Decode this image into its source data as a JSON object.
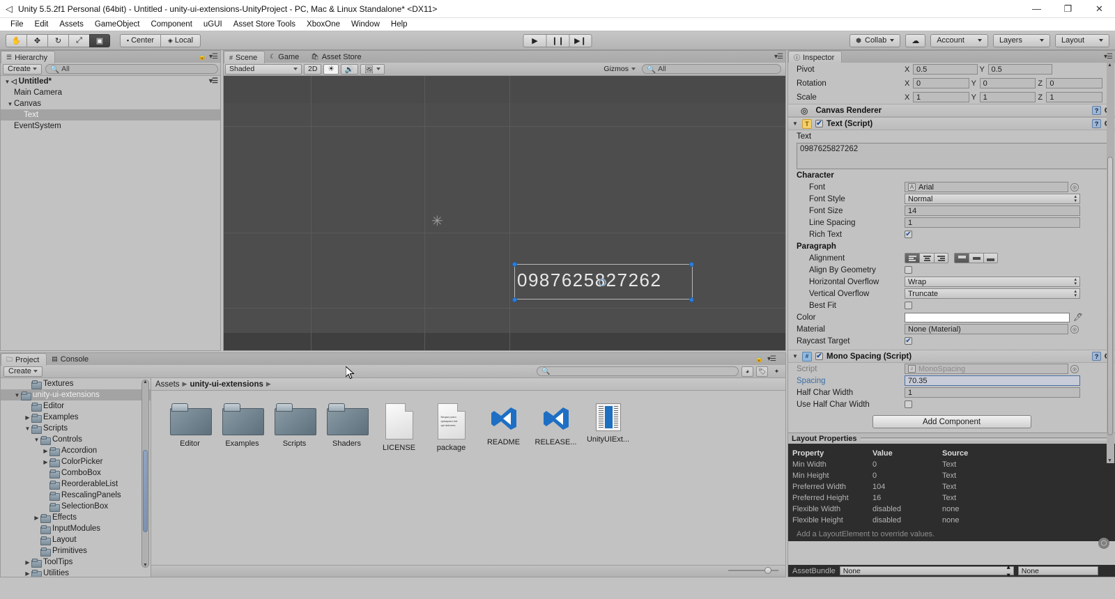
{
  "window": {
    "title": "Unity 5.5.2f1 Personal (64bit) - Untitled - unity-ui-extensions-UnityProject - PC, Mac & Linux Standalone* <DX11>",
    "app_icon": "unity-logo-icon",
    "minimize": "—",
    "maximize": "❐",
    "close": "✕"
  },
  "menubar": {
    "items": [
      "File",
      "Edit",
      "Assets",
      "GameObject",
      "Component",
      "uGUI",
      "Asset Store Tools",
      "XboxOne",
      "Window",
      "Help"
    ]
  },
  "toolbar": {
    "tools": [
      {
        "name": "hand-tool",
        "glyph": "✋",
        "active": false
      },
      {
        "name": "move-tool",
        "glyph": "✥",
        "active": false
      },
      {
        "name": "rotate-tool",
        "glyph": "↻",
        "active": false
      },
      {
        "name": "scale-tool",
        "glyph": "⤢",
        "active": false
      },
      {
        "name": "rect-tool",
        "glyph": "▣",
        "active": true
      }
    ],
    "pivot_mode": "Center",
    "pivot_rotation": "Local",
    "play": "▶",
    "pause": "❙❙",
    "step": "▶❙",
    "collab": "Collab",
    "cloud": "☁",
    "account": "Account",
    "layers": "Layers",
    "layout": "Layout"
  },
  "hierarchy": {
    "tab": "Hierarchy",
    "create_label": "Create",
    "search_placeholder": "All",
    "scene_name": "Untitled*",
    "items": [
      {
        "label": "Main Camera",
        "depth": 1,
        "expandable": false,
        "selected": false
      },
      {
        "label": "Canvas",
        "depth": 1,
        "expandable": true,
        "selected": false
      },
      {
        "label": "Text",
        "depth": 2,
        "expandable": false,
        "selected": true
      },
      {
        "label": "EventSystem",
        "depth": 1,
        "expandable": false,
        "selected": false
      }
    ]
  },
  "scene": {
    "tabs": [
      {
        "label": "Scene",
        "icon": "grid-icon",
        "active": true
      },
      {
        "label": "Game",
        "icon": "gamepad-icon",
        "active": false
      },
      {
        "label": "Asset Store",
        "icon": "store-icon",
        "active": false
      }
    ],
    "draw_mode": "Shaded",
    "mode_2d": "2D",
    "lighting_icon": "sun-icon",
    "audio_icon": "speaker-icon",
    "fx_icon": "image-icon",
    "gizmos": "Gizmos",
    "search_placeholder": "All",
    "selected_object_text": "0987625827262"
  },
  "project": {
    "tabs": [
      {
        "label": "Project",
        "icon": "folder-icon",
        "active": true
      },
      {
        "label": "Console",
        "icon": "console-icon",
        "active": false
      }
    ],
    "create_label": "Create",
    "search_placeholder": "",
    "breadcrumb": [
      "Assets",
      "unity-ui-extensions"
    ],
    "tree": [
      {
        "label": "Textures",
        "depth": 3,
        "arrow": "",
        "selected": false
      },
      {
        "label": "unity-ui-extensions",
        "depth": 2,
        "arrow": "▼",
        "selected": true
      },
      {
        "label": "Editor",
        "depth": 3,
        "arrow": "",
        "selected": false
      },
      {
        "label": "Examples",
        "depth": 3,
        "arrow": "▶",
        "selected": false
      },
      {
        "label": "Scripts",
        "depth": 3,
        "arrow": "▼",
        "selected": false
      },
      {
        "label": "Controls",
        "depth": 4,
        "arrow": "▼",
        "selected": false
      },
      {
        "label": "Accordion",
        "depth": 5,
        "arrow": "▶",
        "selected": false
      },
      {
        "label": "ColorPicker",
        "depth": 5,
        "arrow": "▶",
        "selected": false
      },
      {
        "label": "ComboBox",
        "depth": 5,
        "arrow": "",
        "selected": false
      },
      {
        "label": "ReorderableList",
        "depth": 5,
        "arrow": "",
        "selected": false
      },
      {
        "label": "RescalingPanels",
        "depth": 5,
        "arrow": "",
        "selected": false
      },
      {
        "label": "SelectionBox",
        "depth": 5,
        "arrow": "",
        "selected": false
      },
      {
        "label": "Effects",
        "depth": 4,
        "arrow": "▶",
        "selected": false
      },
      {
        "label": "InputModules",
        "depth": 4,
        "arrow": "",
        "selected": false
      },
      {
        "label": "Layout",
        "depth": 4,
        "arrow": "",
        "selected": false
      },
      {
        "label": "Primitives",
        "depth": 4,
        "arrow": "",
        "selected": false
      },
      {
        "label": "ToolTips",
        "depth": 3,
        "arrow": "▶",
        "selected": false
      },
      {
        "label": "Utilities",
        "depth": 3,
        "arrow": "▶",
        "selected": false
      }
    ],
    "assets": [
      {
        "label": "Editor",
        "kind": "folder"
      },
      {
        "label": "Examples",
        "kind": "folder"
      },
      {
        "label": "Scripts",
        "kind": "folder"
      },
      {
        "label": "Shaders",
        "kind": "folder"
      },
      {
        "label": "LICENSE",
        "kind": "document"
      },
      {
        "label": "package",
        "kind": "text-document",
        "preview": "Neque porro quisquam est qui dolorem."
      },
      {
        "label": "README",
        "kind": "visualstudio"
      },
      {
        "label": "RELEASE...",
        "kind": "visualstudio"
      },
      {
        "label": "UnityUIExt...",
        "kind": "unity-document"
      }
    ]
  },
  "inspector": {
    "tab": "Inspector",
    "transform": {
      "pivot": {
        "label": "Pivot",
        "x": "0.5",
        "y": "0.5"
      },
      "rotation": {
        "label": "Rotation",
        "x": "0",
        "y": "0",
        "z": "0"
      },
      "scale": {
        "label": "Scale",
        "x": "1",
        "y": "1",
        "z": "1"
      }
    },
    "canvas_renderer": {
      "title": "Canvas Renderer",
      "icon": "canvas-renderer-icon"
    },
    "text_component": {
      "title": "Text (Script)",
      "icon": "text-component-icon",
      "enabled": true,
      "text_label": "Text",
      "text_value": "0987625827262",
      "character_section": "Character",
      "font_label": "Font",
      "font_value": "Arial",
      "font_style_label": "Font Style",
      "font_style_value": "Normal",
      "font_size_label": "Font Size",
      "font_size_value": "14",
      "line_spacing_label": "Line Spacing",
      "line_spacing_value": "1",
      "rich_text_label": "Rich Text",
      "rich_text_checked": true,
      "paragraph_section": "Paragraph",
      "alignment_label": "Alignment",
      "alignment_h_selected": 0,
      "alignment_v_selected": 0,
      "align_by_geometry_label": "Align By Geometry",
      "align_by_geometry_checked": false,
      "horizontal_overflow_label": "Horizontal Overflow",
      "horizontal_overflow_value": "Wrap",
      "vertical_overflow_label": "Vertical Overflow",
      "vertical_overflow_value": "Truncate",
      "best_fit_label": "Best Fit",
      "best_fit_checked": false,
      "color_label": "Color",
      "color_value": "#ffffff",
      "material_label": "Material",
      "material_value": "None (Material)",
      "raycast_target_label": "Raycast Target",
      "raycast_target_checked": true
    },
    "mono_spacing": {
      "title": "Mono Spacing (Script)",
      "icon": "script-component-icon",
      "enabled": true,
      "script_label": "Script",
      "script_value": "MonoSpacing",
      "spacing_label": "Spacing",
      "spacing_value": "70.35",
      "half_char_width_label": "Half Char Width",
      "half_char_width_value": "1",
      "use_half_char_width_label": "Use Half Char Width",
      "use_half_char_width_checked": false
    },
    "add_component": "Add Component",
    "layout_properties": {
      "title": "Layout Properties",
      "columns": [
        "Property",
        "Value",
        "Source"
      ],
      "rows": [
        [
          "Min Width",
          "0",
          "Text"
        ],
        [
          "Min Height",
          "0",
          "Text"
        ],
        [
          "Preferred Width",
          "104",
          "Text"
        ],
        [
          "Preferred Height",
          "16",
          "Text"
        ],
        [
          "Flexible Width",
          "disabled",
          "none"
        ],
        [
          "Flexible Height",
          "disabled",
          "none"
        ]
      ],
      "note": "Add a LayoutElement to override values."
    },
    "asset_bundle": {
      "label": "AssetBundle",
      "name_value": "None",
      "variant_value": "None"
    }
  },
  "colors": {
    "accent_blue": "#2f7fdd",
    "panel_bg": "#c2c2c2",
    "scene_bg": "#4b4b4b",
    "dark_panel": "#2d2d2d",
    "link_blue": "#3a6ea5"
  }
}
